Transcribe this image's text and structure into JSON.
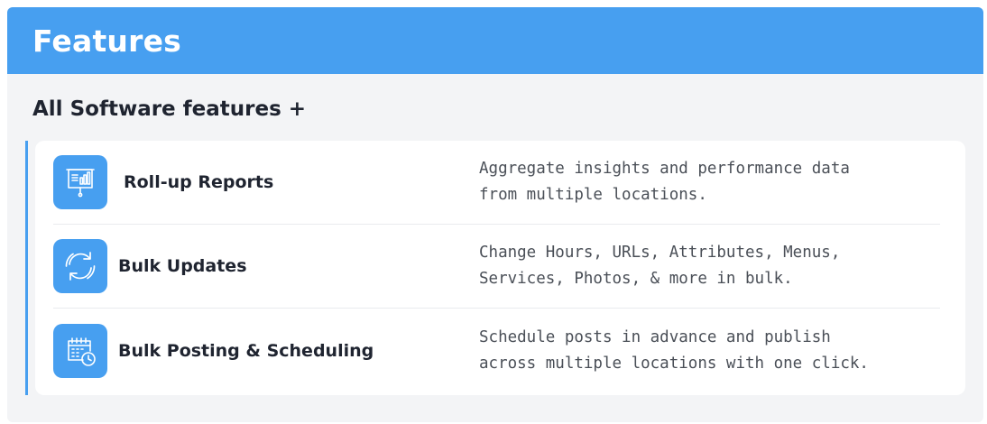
{
  "header": {
    "title": "Features"
  },
  "subtitle": "All Software features +",
  "features": [
    {
      "icon": "presentation-chart-icon",
      "name": "Roll-up Reports",
      "description_line1": "Aggregate insights and performance data",
      "description_line2": "from multiple locations."
    },
    {
      "icon": "refresh-icon",
      "name": "Bulk Updates",
      "description_line1": "Change Hours, URLs, Attributes, Menus,",
      "description_line2": "Services, Photos, & more in bulk."
    },
    {
      "icon": "calendar-clock-icon",
      "name": "Bulk Posting & Scheduling",
      "description_line1": "Schedule posts in advance and publish",
      "description_line2": "across multiple locations with one click."
    }
  ],
  "colors": {
    "accent": "#479ff0",
    "card_bg": "#f3f4f6",
    "text_dark": "#1f2430",
    "text_body": "#4a4f57"
  }
}
